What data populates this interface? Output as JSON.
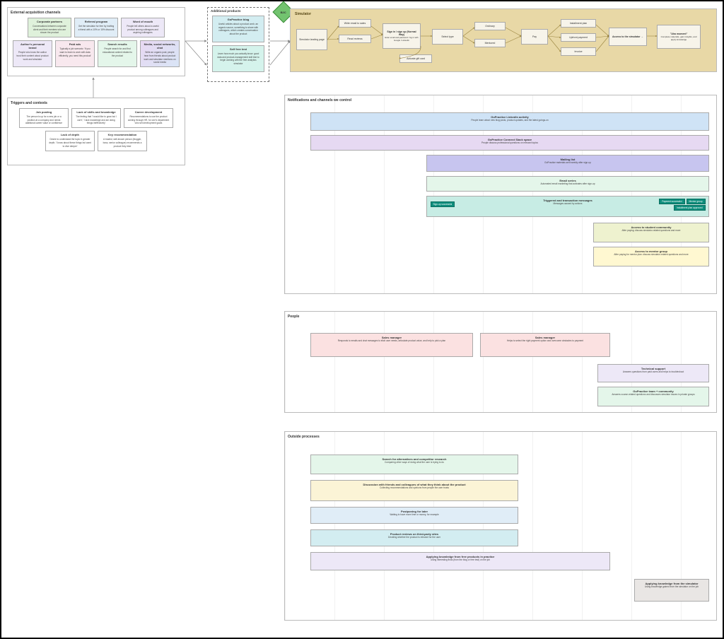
{
  "external": {
    "title": "External acquisition channels",
    "cards": [
      {
        "title": "Corporate partners",
        "body": "Conversations between corporate client and their mentees who are shown the product"
      },
      {
        "title": "Referral program",
        "body": "Get the simulator for free by inviting a friend with a 10% or 15% discount"
      },
      {
        "title": "Word of mouth",
        "body": "People tell others about a useful product among colleagues and aspiring colleagues"
      },
      {
        "title": "Author's personal brand",
        "body": "People who know the author trust their content about product work and simulator"
      },
      {
        "title": "Paid ads",
        "body": "Typically a job scenario: 'If you want to learn to work with data efficiently, you need this product'"
      },
      {
        "title": "Search results",
        "body": "People search for and find educational content related to the product"
      },
      {
        "title": "Media, social networks, chat",
        "body": "Write an organic post; people hear from friends about product work and simulator mentions on social media"
      }
    ]
  },
  "triggers": {
    "title": "Triggers and contexts",
    "cards": [
      {
        "title": "Job posting",
        "body": "The person is up for a new job or a position at a company and needs additional career value or confidence"
      },
      {
        "title": "Lack of skills and knowledge",
        "body": "The feeling that 'I would like to grow but I can't', 'I lack knowledge and am doing things ineffectively'"
      },
      {
        "title": "Career development",
        "body": "Recommendations to use the product coming through HR, for one's department who set development goals"
      },
      {
        "title": "Lack of depth",
        "body": "Desire to understand the topic in greater depth; 'I know about these things but want to dive deeper'"
      },
      {
        "title": "Key recommendation",
        "body": "A trusted, well-known person (blogger, boss, senior colleague) recommends a product they tried"
      }
    ]
  },
  "addl": {
    "title": "Additional products",
    "blog": {
      "title": "GoPractice blog",
      "body": "Useful articles about a product work: an organic source, something to share with colleagues, which creates conversation about the product"
    },
    "test": {
      "title": "Self free test",
      "body": "Learn how much you actually know: good data and product-management skill test to begin working with the free analytics simulator"
    }
  },
  "diamond": "B2C",
  "simulator": {
    "title": "Simulator",
    "landing": "Simulator landing page",
    "email": "Write email to sales",
    "reviews": "Read reviews",
    "signin": {
      "t": "Sign in / sign up (Normal Way)",
      "b": "Enter email and password / log in with Google / LinkedIn"
    },
    "select": "Select type",
    "ordinary": "Ordinary",
    "mentored": "Mentored",
    "pay": "Pay",
    "install": "Installment plan",
    "upfront": "Upfront payment",
    "invoice": "Invoice",
    "gift": "Activate gift card",
    "access": {
      "t": "Access to the simulator →",
      "b": ""
    },
    "aha": {
      "t": "\"Aha moment\"",
      "b": "Complete materials, gain insights, and apply knowledge"
    }
  },
  "notifications": {
    "title": "Notifications and channels we control",
    "linkedin": {
      "t": "GoPractice LinkedIn activity",
      "b": "People learn about new blog posts, product updates, and the latest goings-on"
    },
    "slack": {
      "t": "GoPractice Connect Slack space",
      "b": "People discuss professional questions on relevant topics"
    },
    "mailing": {
      "t": "Mailing list",
      "b": "GoPractice materials sent weekly after sign-up"
    },
    "emailseries": {
      "t": "Email series",
      "b": "Automated email marketing that activates after sign-up"
    },
    "triggered": {
      "t": "Triggered and transaction messages",
      "b": "Messages caused by actions"
    },
    "signup": "Sign-up successful",
    "chips": [
      "Payment successful",
      "Mentor group",
      "Installment plan approved"
    ],
    "studentcomm": {
      "t": "Access to student community",
      "b": "After paying: discuss simulator-related questions and more"
    },
    "mentorgroup": {
      "t": "Access to mentor group",
      "b": "After paying for mentor plan: discuss simulator-related questions and more"
    }
  },
  "people": {
    "title": "People",
    "sm1": {
      "t": "Sales manager",
      "b": "Responds to emails and chat messages to elicit user needs, articulate product value, and help to pick a plan"
    },
    "sm2": {
      "t": "Sales manager",
      "b": "Helps to select the right payment option and overcome obstacles to payment"
    },
    "tech": {
      "t": "Technical support",
      "b": "Answers questions from paid users and helps to troubleshoot"
    },
    "comm": {
      "t": "GoPractice team + community",
      "b": "Answers course-related questions and discusses simulator issues in private groups"
    }
  },
  "outside": {
    "title": "Outside processes",
    "search": {
      "t": "Search for alternatives and competitor research",
      "b": "Comparing other ways of doing what the user is trying to do"
    },
    "discuss": {
      "t": "Discussion with friends and colleagues of what they think about the product",
      "b": "Collecting recommendations and opinions from people the user trusts"
    },
    "postpone": {
      "t": "Postponing for later",
      "b": "Waiting to have more time or money, for example"
    },
    "reviews": {
      "t": "Product reviews on third-party sites",
      "b": "Deciding whether the product is relevant for the user"
    },
    "applyfree": {
      "t": "Applying knowledge from free products in practice",
      "b": "Using interesting finds (from the blog or free test) on the job"
    },
    "applysim": {
      "t": "Applying knowledge from the simulator",
      "b": "Using knowledge gained from the simulator on the job"
    }
  }
}
